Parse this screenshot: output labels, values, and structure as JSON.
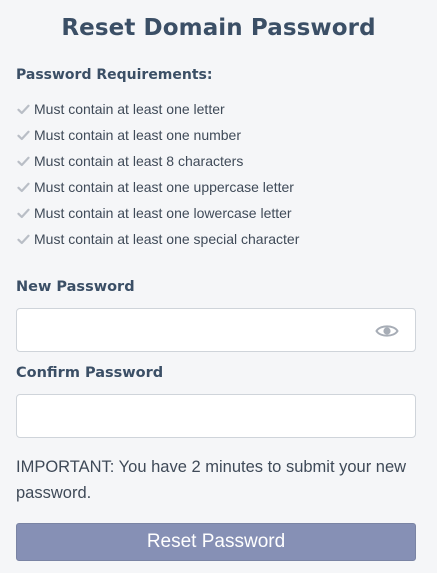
{
  "title": "Reset Domain Password",
  "requirements": {
    "heading": "Password Requirements:",
    "items": [
      "Must contain at least one letter",
      "Must contain at least one number",
      "Must contain at least 8 characters",
      "Must contain at least one uppercase letter",
      "Must contain at least one lowercase letter",
      "Must contain at least one special character"
    ],
    "icon": "check-icon",
    "icon_color": "#b9bec6"
  },
  "new_password": {
    "label": "New Password",
    "value": "",
    "placeholder": "",
    "toggle_icon": "eye-icon"
  },
  "confirm_password": {
    "label": "Confirm Password",
    "value": "",
    "placeholder": ""
  },
  "notice": "IMPORTANT: You have 2 minutes to submit your new password.",
  "submit": {
    "label": "Reset Password",
    "color": "#8690b5"
  },
  "colors": {
    "heading": "#3b4f66",
    "background": "#f5f6f8"
  }
}
